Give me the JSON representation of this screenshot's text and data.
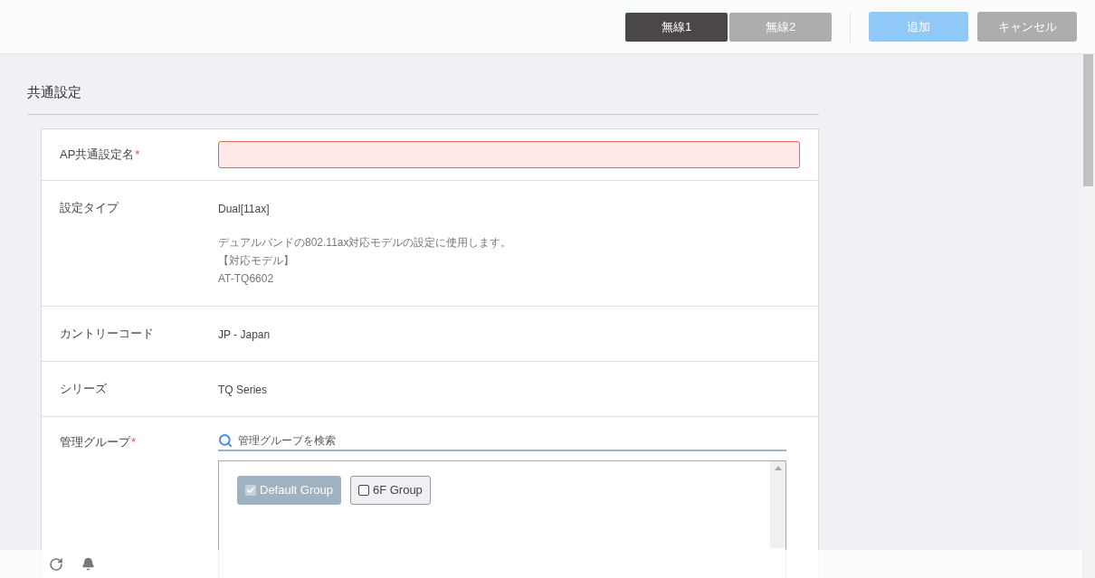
{
  "tabs": [
    {
      "label": "無線1",
      "selected": true
    },
    {
      "label": "無線2",
      "selected": false
    }
  ],
  "actions": [
    {
      "label": "追加",
      "kind": "primary"
    },
    {
      "label": "キャンセル",
      "kind": "secondary"
    }
  ],
  "section": {
    "title": "共通設定"
  },
  "rows": [
    {
      "kind": "input",
      "label": "AP共通設定名",
      "mark": "*",
      "invalid": true
    },
    {
      "kind": "text",
      "label": "設定タイプ",
      "value": "Dual[11ax]",
      "notes": [
        "デュアルバンドの802.11ax対応モデルの設定に使用します。",
        "【対応モデル】",
        "AT-TQ6602"
      ]
    },
    {
      "kind": "text",
      "label": "カントリーコード",
      "value": "JP - Japan"
    },
    {
      "kind": "text",
      "label": "シリーズ",
      "value": "TQ Series"
    },
    {
      "kind": "groups",
      "label": "管理グループ",
      "mark": "*",
      "placeholder": "管理グループを検索",
      "groups": [
        {
          "label": "Default Group",
          "checked": true,
          "disabled": true
        },
        {
          "label": "6F Group",
          "checked": false,
          "disabled": false
        }
      ]
    }
  ]
}
